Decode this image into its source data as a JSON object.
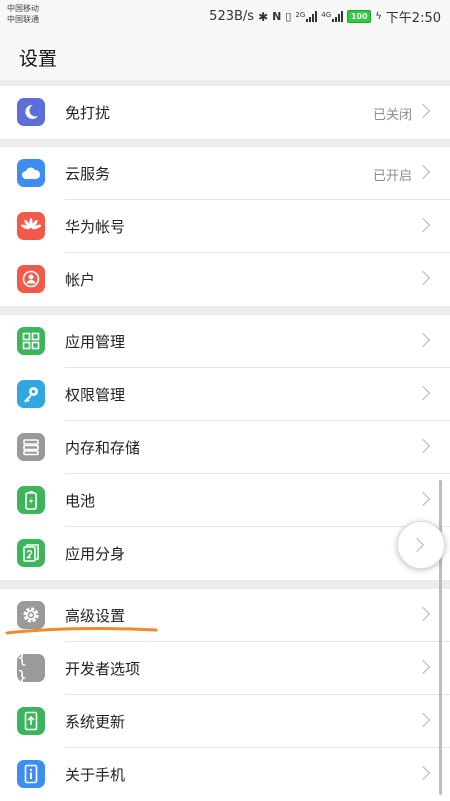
{
  "status_bar": {
    "carrier1": "中国移动",
    "carrier2": "中国联通",
    "speed": "523B/s",
    "net1": "2G",
    "net2": "4G",
    "battery": "100",
    "time": "下午2:50"
  },
  "header": {
    "title": "设置"
  },
  "groups": [
    {
      "items": [
        {
          "label": "免打扰",
          "value": "已关闭",
          "icon": "moon-icon",
          "color": "#5b6fd6"
        }
      ]
    },
    {
      "items": [
        {
          "label": "云服务",
          "value": "已开启",
          "icon": "cloud-icon",
          "color": "#3d8ef0"
        },
        {
          "label": "华为帐号",
          "value": "",
          "icon": "huawei-icon",
          "color": "#f15a4a"
        },
        {
          "label": "帐户",
          "value": "",
          "icon": "account-icon",
          "color": "#f15a4a"
        }
      ]
    },
    {
      "items": [
        {
          "label": "应用管理",
          "value": "",
          "icon": "apps-grid-icon",
          "color": "#3cb55c"
        },
        {
          "label": "权限管理",
          "value": "",
          "icon": "key-icon",
          "color": "#2fa8e0"
        },
        {
          "label": "内存和存储",
          "value": "",
          "icon": "storage-icon",
          "color": "#9a9a9a"
        },
        {
          "label": "电池",
          "value": "",
          "icon": "battery-icon",
          "color": "#3cb55c"
        },
        {
          "label": "应用分身",
          "value": "",
          "icon": "app-twin-icon",
          "color": "#3cb55c"
        }
      ]
    },
    {
      "items": [
        {
          "label": "高级设置",
          "value": "",
          "icon": "gear-icon",
          "color": "#9a9a9a"
        },
        {
          "label": "开发者选项",
          "value": "",
          "icon": "braces-icon",
          "color": "#9a9a9a"
        },
        {
          "label": "系统更新",
          "value": "",
          "icon": "system-update-icon",
          "color": "#3cb55c"
        },
        {
          "label": "关于手机",
          "value": "",
          "icon": "info-icon",
          "color": "#3d8ef0"
        }
      ]
    }
  ],
  "annotation_color": "#f08a2c"
}
